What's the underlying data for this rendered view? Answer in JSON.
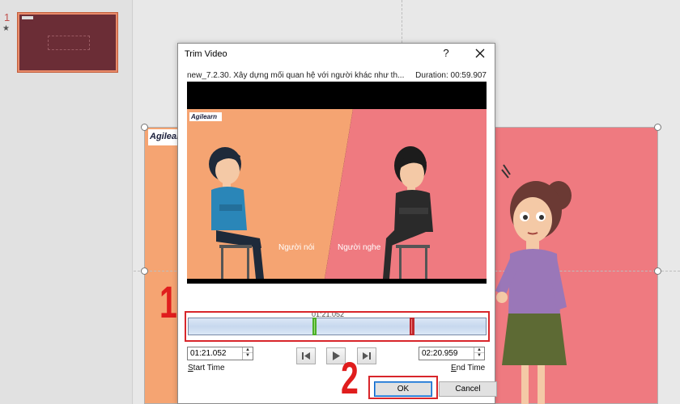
{
  "thumbnails": {
    "slide_number": "1",
    "star": "★"
  },
  "slide": {
    "logo_text": "Agilearn"
  },
  "steps": {
    "step1": "1",
    "step2": "2"
  },
  "dialog": {
    "title": "Trim Video",
    "help": "?",
    "file_name": "new_7.2.30. Xây dựng mối quan hệ với người khác như th...",
    "duration": "Duration: 00:59.907",
    "video": {
      "logo_text": "Agilearn",
      "label_speaker": "Người nói",
      "label_listener": "Người nghe"
    },
    "timeline": {
      "pointer_time": "01:21.052"
    },
    "start_time": {
      "value": "01:21.052",
      "label_underlined": "S",
      "label_rest": "tart Time"
    },
    "end_time": {
      "value": "02:20.959",
      "label_underlined": "E",
      "label_rest": "nd Time"
    },
    "buttons": {
      "ok": "OK",
      "cancel": "Cancel"
    }
  },
  "colors": {
    "highlight_red": "#d8262b",
    "start_marker": "#4caf2a",
    "end_marker": "#c0282d",
    "accent_blue": "#0a64c8"
  }
}
